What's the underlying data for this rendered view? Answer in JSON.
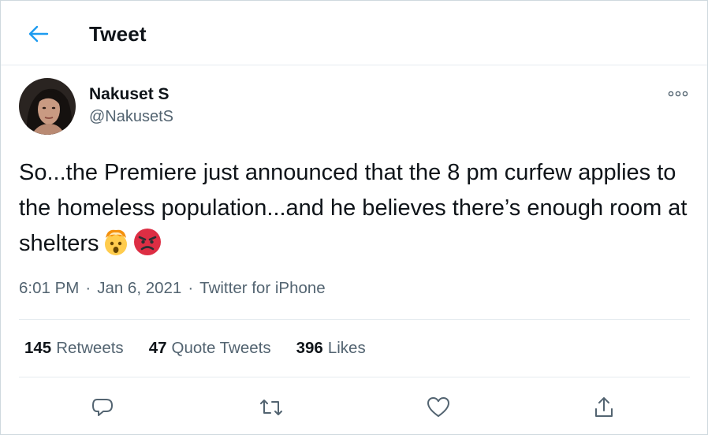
{
  "header": {
    "title": "Tweet",
    "back_icon": "arrow-left-icon"
  },
  "author": {
    "name": "Nakuset S",
    "handle": "@NakusetS"
  },
  "tweet": {
    "text": "So...the Premiere just announced that the 8 pm curfew applies to the homeless population...and he believes there’s enough room at shelters",
    "emojis": [
      "exploding-head-emoji",
      "angry-face-emoji"
    ],
    "time": "6:01 PM",
    "date": "Jan 6, 2021",
    "separator": "·",
    "source": "Twitter for iPhone"
  },
  "stats": {
    "retweets_count": "145",
    "retweets_label": "Retweets",
    "quotes_count": "47",
    "quotes_label": "Quote Tweets",
    "likes_count": "396",
    "likes_label": "Likes"
  },
  "actions": [
    "reply-icon",
    "retweet-icon",
    "like-icon",
    "share-icon"
  ],
  "colors": {
    "accent": "#1d9bf0",
    "text": "#0f1419",
    "secondary": "#536471",
    "divider": "#e6ecf0"
  }
}
